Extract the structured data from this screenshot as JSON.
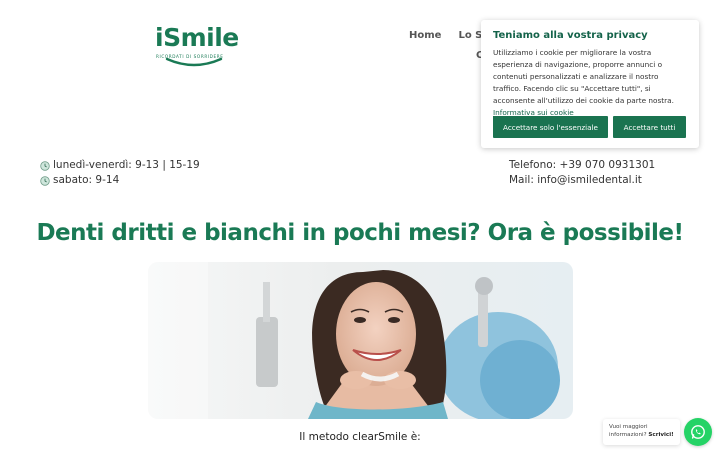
{
  "logo": {
    "word": "iSmile",
    "tagline": "RICORDATI DI SORRIDERE"
  },
  "nav": {
    "items": [
      "Home",
      "Lo Stu"
    ],
    "second_line": "C"
  },
  "hours": {
    "weekdays": "lunedì-venerdì: 9-13 | 15-19",
    "saturday": "sabato: 9-14"
  },
  "contact": {
    "phone": "Telefono: +39 070 0931301",
    "mail": "Mail: info@ismiledental.it"
  },
  "headline": "Denti dritti e bianchi in pochi mesi? Ora è possibile!",
  "method_intro": "Il metodo clearSmile è:",
  "cookie": {
    "title": "Teniamo alla vostra privacy",
    "text": "Utilizziamo i cookie per migliorare la vostra esperienza di navigazione, proporre annunci o contenuti personalizzati e analizzare il nostro traffico. Facendo clic su \"Accettare tutti\", si acconsente all'utilizzo dei cookie da parte nostra.",
    "link": "Informativa sui cookie",
    "accept_essential": "Accettare solo l'essenziale",
    "accept_all": "Accettare tutti"
  },
  "whatsapp": {
    "line1": "Vuoi maggiori",
    "line2": "informazioni?",
    "cta": "Scrivici!"
  },
  "colors": {
    "brand_green": "#1a7a55",
    "button_green": "#1a7350",
    "whatsapp_green": "#25d366"
  }
}
